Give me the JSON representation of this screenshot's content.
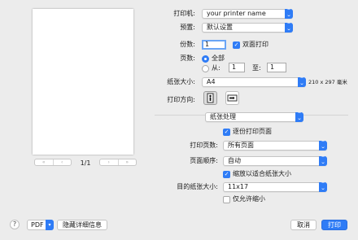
{
  "preview": {
    "page_indicator": "1/1",
    "first_icon": "«",
    "prev_icon": "‹",
    "next_icon": "›",
    "last_icon": "»"
  },
  "printer": {
    "label": "打印机:",
    "value": "your printer name"
  },
  "presets": {
    "label": "预置:",
    "value": "默认设置"
  },
  "copies": {
    "label": "份数:",
    "value": "1",
    "two_sided_label": "双面打印",
    "two_sided_checked": true
  },
  "pages": {
    "label": "页数:",
    "all_label": "全部",
    "from_label": "从:",
    "from_value": "1",
    "to_label": "至:",
    "to_value": "1",
    "selected": "all"
  },
  "paper_size": {
    "label": "纸张大小:",
    "value": "A4",
    "dimensions": "210 x 297 毫米"
  },
  "orientation": {
    "label": "打印方向:",
    "selected": "portrait"
  },
  "section": {
    "value": "纸张处理"
  },
  "collate": {
    "label": "逐份打印页面",
    "checked": true
  },
  "pages_to_print": {
    "label": "打印页数:",
    "value": "所有页面"
  },
  "page_order": {
    "label": "页面顺序:",
    "value": "自动"
  },
  "scale_to_fit": {
    "label": "缩放以适合纸张大小",
    "checked": true
  },
  "destination_paper": {
    "label": "目的纸张大小:",
    "value": "11x17"
  },
  "scale_down_only": {
    "label": "仅允许缩小",
    "checked": false
  },
  "footer": {
    "help": "?",
    "pdf_label": "PDF",
    "hide_details": "隐藏详细信息",
    "cancel": "取消",
    "print": "打印"
  },
  "colors": {
    "accent": "#2f7cf6",
    "background": "#ececec"
  }
}
